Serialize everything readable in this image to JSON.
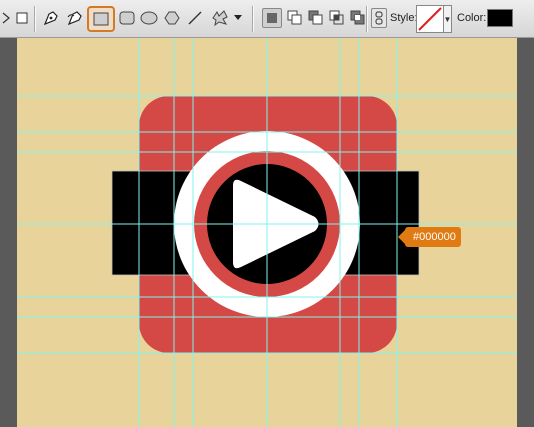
{
  "toolbar": {
    "tools": [
      {
        "name": "pen-tool-icon"
      },
      {
        "name": "freeform-pen-tool-icon"
      },
      {
        "name": "rectangle-tool-icon",
        "selected": true
      },
      {
        "name": "rounded-rectangle-tool-icon"
      },
      {
        "name": "ellipse-tool-icon"
      },
      {
        "name": "polygon-tool-icon"
      },
      {
        "name": "line-tool-icon"
      },
      {
        "name": "custom-shape-tool-icon"
      }
    ],
    "style_label": "Style:",
    "color_label": "Color:",
    "color_value": "#000000"
  },
  "canvas": {
    "background_color": "#e8d49a",
    "icon_color": "#d44945",
    "band_color": "#000000",
    "ring_color": "#ffffff",
    "guide_color": "#7ff4ec"
  },
  "tooltip": {
    "text": "#000000",
    "color": "#e07a12"
  }
}
